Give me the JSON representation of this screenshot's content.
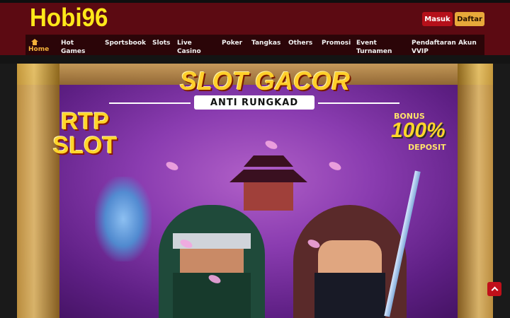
{
  "site": {
    "logo_text": "Hobi96"
  },
  "auth": {
    "login_label": "Masuk",
    "register_label": "Daftar"
  },
  "nav": {
    "items": [
      {
        "label": "Home",
        "icon": "home-icon",
        "active": true
      },
      {
        "label": "Hot Games"
      },
      {
        "label": "Sportsbook"
      },
      {
        "label": "Slots"
      },
      {
        "label": "Live Casino"
      },
      {
        "label": "Poker"
      },
      {
        "label": "Tangkas"
      },
      {
        "label": "Others"
      },
      {
        "label": "Promosi"
      },
      {
        "label": "Event Turnamen"
      },
      {
        "label": "Pendaftaran Akun VVIP"
      }
    ]
  },
  "banner": {
    "title": "SLOT GACOR",
    "subtitle": "ANTI RUNGKAD",
    "rtp_line1": "RTP",
    "rtp_line2": "SLOT",
    "bonus_small": "BONUS",
    "bonus_big": "100%",
    "bonus_deposit": "DEPOSIT"
  },
  "scroll_top": {
    "icon": "chevron-up-icon"
  },
  "colors": {
    "header_bg": "#5c0a12",
    "nav_bg": "#2b0508",
    "accent_gold": "#f3b13a",
    "logo_yellow": "#ffe81a",
    "login_red": "#b5101a",
    "register_orange": "#e8a93a"
  }
}
